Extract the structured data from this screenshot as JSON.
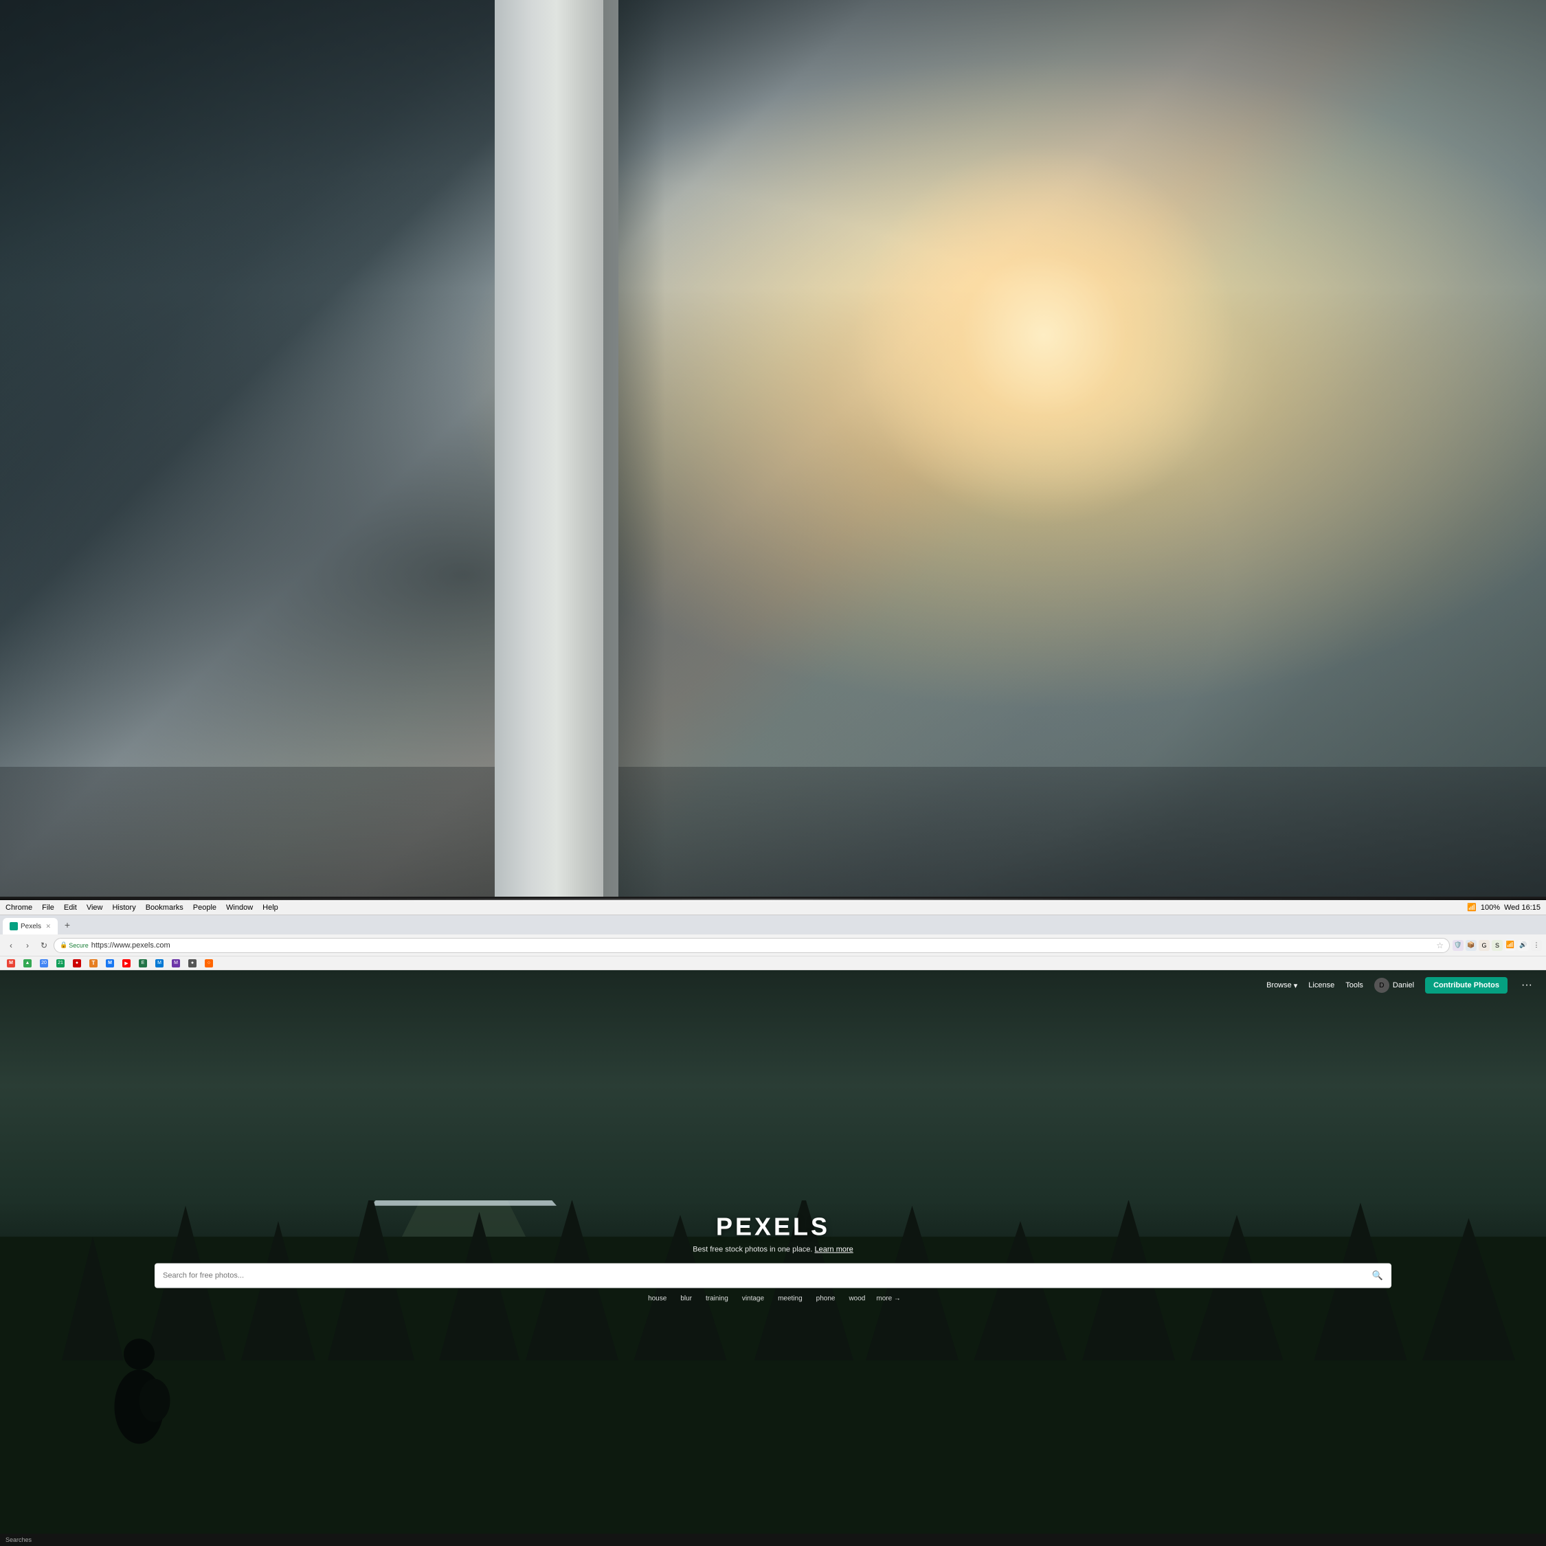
{
  "background": {
    "description": "Office/workspace background photo, blurred",
    "overlay": "Dark office interior with large windows and warm light"
  },
  "menubar": {
    "app_name": "Chrome",
    "items": [
      "File",
      "Edit",
      "View",
      "History",
      "Bookmarks",
      "People",
      "Window",
      "Help"
    ],
    "time": "Wed 16:15",
    "battery": "100%"
  },
  "browser": {
    "secure_label": "Secure",
    "url": "https://www.pexels.com",
    "tab_title": "Pexels"
  },
  "bookmarks": [
    {
      "label": "M",
      "color": "gmail"
    },
    {
      "label": "▲",
      "color": "drive"
    },
    {
      "label": "20",
      "color": "blue"
    },
    {
      "label": "21",
      "color": "teal"
    },
    {
      "label": "●",
      "color": "red"
    },
    {
      "label": "T",
      "color": "orange"
    },
    {
      "label": "M",
      "color": "purple"
    },
    {
      "label": "Y",
      "color": "red"
    },
    {
      "label": "E",
      "color": "green"
    },
    {
      "label": "M",
      "color": "blue"
    }
  ],
  "pexels": {
    "logo": "PEXELS",
    "nav": {
      "browse_label": "Browse",
      "license_label": "License",
      "tools_label": "Tools",
      "username": "Daniel",
      "contribute_label": "Contribute Photos",
      "more_label": "···"
    },
    "hero": {
      "title": "PEXELS",
      "subtitle": "Best free stock photos in one place.",
      "learn_more": "Learn more",
      "search_placeholder": "Search for free photos...",
      "suggestions": [
        "house",
        "blur",
        "training",
        "vintage",
        "meeting",
        "phone",
        "wood"
      ],
      "more_label": "more →"
    }
  },
  "statusbar": {
    "label": "Searches"
  }
}
